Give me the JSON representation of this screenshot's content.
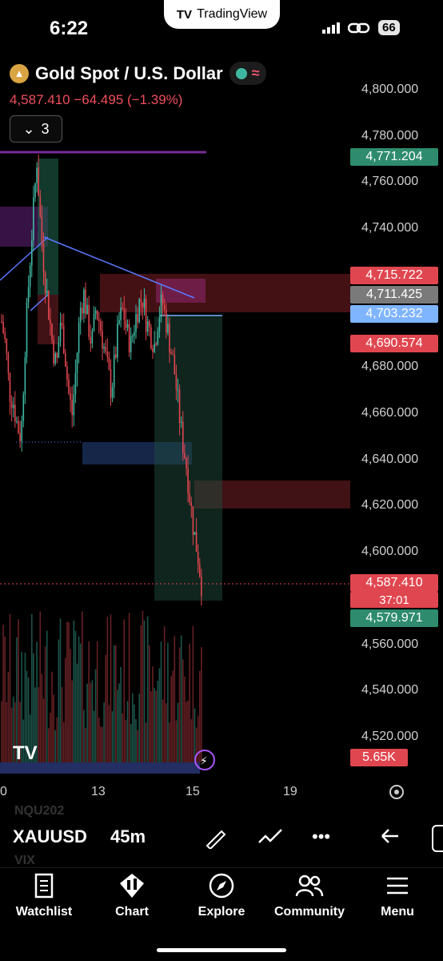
{
  "status_bar": {
    "time": "6:22",
    "app_pill": "TradingView",
    "battery": "66"
  },
  "header": {
    "title": "Gold Spot / U.S. Dollar",
    "quote": "4,587.410 −64.495 (−1.39%)",
    "indicator_count": "3"
  },
  "chart_data": {
    "type": "candlestick",
    "title": "Gold Spot / U.S. Dollar",
    "y_ticks": [
      "4,800.000",
      "4,780.000",
      "4,760.000",
      "4,740.000",
      "4,680.000",
      "4,660.000",
      "4,640.000",
      "4,620.000",
      "4,600.000",
      "4,560.000",
      "4,540.000",
      "4,520.000"
    ],
    "ylim": [
      4506,
      4812
    ],
    "x_ticks": [
      "0",
      "13",
      "15",
      "19"
    ],
    "price_tags": [
      {
        "label": "4,771.204",
        "color": "#2e8b6e"
      },
      {
        "label": "4,715.722",
        "color": "#e0464f"
      },
      {
        "label": "4,711.425",
        "color": "#7a7a7a"
      },
      {
        "label": "4,703.232",
        "color": "#7fb4ff"
      },
      {
        "label": "4,690.574",
        "color": "#e0464f"
      },
      {
        "label": "4,587.410",
        "color": "#e0464f"
      },
      {
        "label": "4,579.971",
        "color": "#2e8b6e"
      }
    ],
    "countdown": "37:01",
    "volume_label": "5.65K",
    "last_price": 4587.41
  },
  "toolbar": {
    "symbol": "XAUUSD",
    "interval": "45m",
    "ghost_symbol_above": "NQU202",
    "ghost_symbol_below": "VIX"
  },
  "tabs": [
    {
      "label": "Watchlist",
      "icon": "watchlist-icon"
    },
    {
      "label": "Chart",
      "icon": "chart-icon"
    },
    {
      "label": "Explore",
      "icon": "compass-icon"
    },
    {
      "label": "Community",
      "icon": "community-icon"
    },
    {
      "label": "Menu",
      "icon": "menu-icon"
    }
  ],
  "colors": {
    "up": "#3fb8a2",
    "down": "#e0464f",
    "background": "#000000"
  }
}
